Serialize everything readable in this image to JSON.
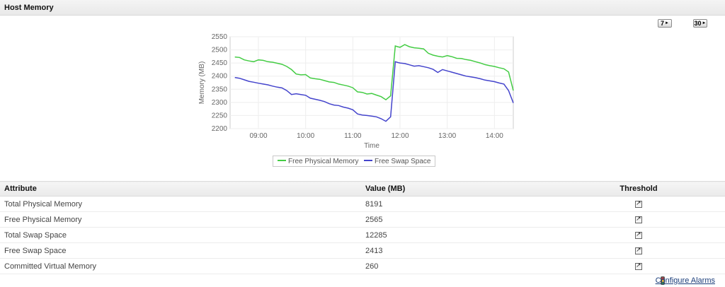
{
  "panel": {
    "title": "Host Memory"
  },
  "period_buttons": [
    {
      "label": "7"
    },
    {
      "label": "30"
    }
  ],
  "chart_data": {
    "type": "line",
    "xlabel": "Time",
    "ylabel": "Memory (MB)",
    "ylim": [
      2200,
      2550
    ],
    "yticks": [
      2200,
      2250,
      2300,
      2350,
      2400,
      2450,
      2500,
      2550
    ],
    "xlim": [
      8.4,
      14.4
    ],
    "xticks": [
      {
        "v": 9,
        "label": "09:00"
      },
      {
        "v": 10,
        "label": "10:00"
      },
      {
        "v": 11,
        "label": "11:00"
      },
      {
        "v": 12,
        "label": "12:00"
      },
      {
        "v": 13,
        "label": "13:00"
      },
      {
        "v": 14,
        "label": "14:00"
      }
    ],
    "grid": true,
    "legend": "bottom",
    "series": [
      {
        "name": "Free Physical Memory",
        "color": "#44cc44",
        "x": [
          8.5,
          8.6,
          8.7,
          8.8,
          8.9,
          9.0,
          9.1,
          9.2,
          9.3,
          9.4,
          9.5,
          9.6,
          9.7,
          9.8,
          9.9,
          10.0,
          10.1,
          10.2,
          10.3,
          10.4,
          10.5,
          10.6,
          10.7,
          10.8,
          10.9,
          11.0,
          11.1,
          11.2,
          11.3,
          11.4,
          11.5,
          11.6,
          11.7,
          11.8,
          11.9,
          11.95,
          12.0,
          12.1,
          12.2,
          12.3,
          12.4,
          12.5,
          12.6,
          12.7,
          12.8,
          12.9,
          13.0,
          13.1,
          13.2,
          13.3,
          13.4,
          13.5,
          13.6,
          13.7,
          13.8,
          13.9,
          14.0,
          14.1,
          14.2,
          14.3,
          14.4
        ],
        "values": [
          2473,
          2471,
          2462,
          2458,
          2455,
          2462,
          2460,
          2455,
          2453,
          2449,
          2445,
          2437,
          2425,
          2408,
          2405,
          2406,
          2393,
          2390,
          2388,
          2383,
          2378,
          2376,
          2370,
          2366,
          2362,
          2356,
          2340,
          2338,
          2332,
          2334,
          2328,
          2322,
          2310,
          2325,
          2515,
          2512,
          2510,
          2520,
          2512,
          2508,
          2506,
          2504,
          2487,
          2480,
          2476,
          2473,
          2478,
          2474,
          2468,
          2467,
          2463,
          2460,
          2455,
          2450,
          2444,
          2440,
          2437,
          2432,
          2428,
          2416,
          2345
        ]
      },
      {
        "name": "Free Swap Space",
        "color": "#4444cc",
        "x": [
          8.5,
          8.6,
          8.7,
          8.8,
          8.9,
          9.0,
          9.1,
          9.2,
          9.3,
          9.4,
          9.5,
          9.6,
          9.7,
          9.8,
          9.9,
          10.0,
          10.1,
          10.2,
          10.3,
          10.4,
          10.5,
          10.6,
          10.7,
          10.8,
          10.9,
          11.0,
          11.1,
          11.2,
          11.3,
          11.4,
          11.5,
          11.6,
          11.7,
          11.8,
          11.9,
          11.95,
          12.0,
          12.1,
          12.2,
          12.3,
          12.4,
          12.5,
          12.6,
          12.7,
          12.8,
          12.9,
          13.0,
          13.1,
          13.2,
          13.3,
          13.4,
          13.5,
          13.6,
          13.7,
          13.8,
          13.9,
          14.0,
          14.1,
          14.2,
          14.3,
          14.4
        ],
        "values": [
          2395,
          2392,
          2386,
          2380,
          2377,
          2373,
          2370,
          2367,
          2362,
          2358,
          2355,
          2345,
          2330,
          2333,
          2330,
          2327,
          2316,
          2312,
          2308,
          2303,
          2295,
          2290,
          2288,
          2282,
          2278,
          2272,
          2256,
          2252,
          2250,
          2248,
          2245,
          2238,
          2228,
          2245,
          2455,
          2452,
          2450,
          2448,
          2443,
          2438,
          2440,
          2436,
          2432,
          2426,
          2414,
          2425,
          2420,
          2415,
          2410,
          2405,
          2400,
          2397,
          2394,
          2390,
          2385,
          2382,
          2379,
          2374,
          2370,
          2345,
          2298
        ]
      }
    ]
  },
  "table": {
    "headers": {
      "attribute": "Attribute",
      "value": "Value (MB)",
      "threshold": "Threshold"
    },
    "rows": [
      {
        "attribute": "Total Physical Memory",
        "value": "8191"
      },
      {
        "attribute": "Free Physical Memory",
        "value": "2565"
      },
      {
        "attribute": "Total Swap Space",
        "value": "12285"
      },
      {
        "attribute": "Free Swap Space",
        "value": "2413"
      },
      {
        "attribute": "Committed Virtual Memory",
        "value": "260"
      }
    ]
  },
  "footer": {
    "configure_alarms": "Configure Alarms"
  }
}
